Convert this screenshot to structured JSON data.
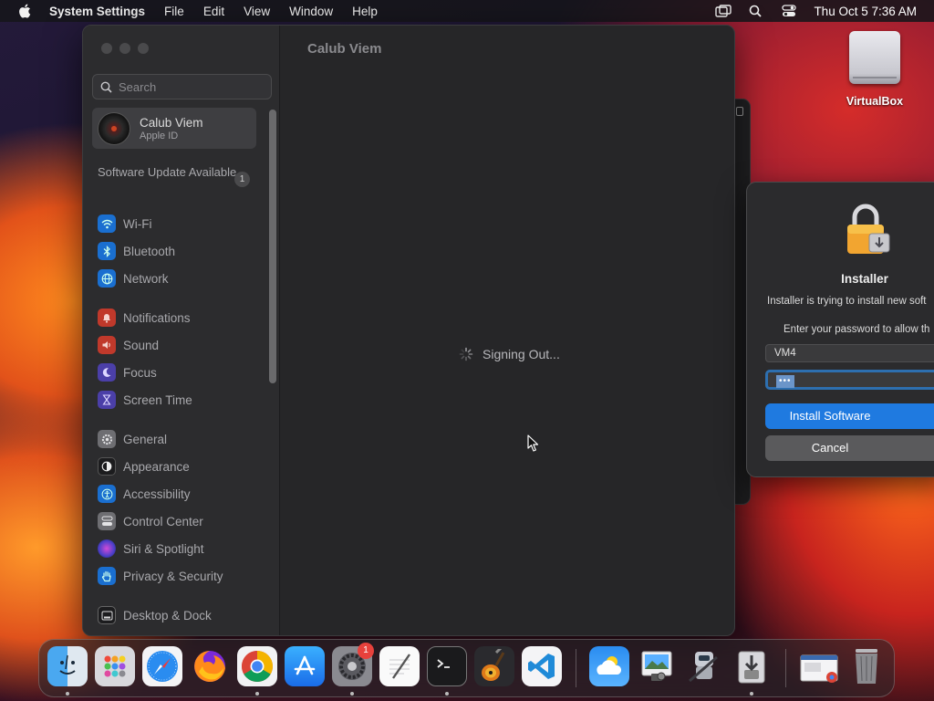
{
  "menubar": {
    "app_name": "System Settings",
    "items": [
      "File",
      "Edit",
      "View",
      "Window",
      "Help"
    ],
    "clock": "Thu Oct 5  7:36 AM"
  },
  "desktop": {
    "icons": [
      {
        "label": "VirtualBox",
        "icon": "external-drive-icon"
      }
    ]
  },
  "settings": {
    "content_title": "Calub Viem",
    "search_placeholder": "Search",
    "account": {
      "name": "Calub Viem",
      "subtitle": "Apple ID"
    },
    "software_update": {
      "label": "Software Update Available",
      "count": "1"
    },
    "sidebar_items": [
      {
        "label": "Wi-Fi",
        "icon": "wifi-icon"
      },
      {
        "label": "Bluetooth",
        "icon": "bluetooth-icon"
      },
      {
        "label": "Network",
        "icon": "globe-icon"
      },
      {
        "label": "Notifications",
        "icon": "bell-icon"
      },
      {
        "label": "Sound",
        "icon": "speaker-icon"
      },
      {
        "label": "Focus",
        "icon": "moon-icon"
      },
      {
        "label": "Screen Time",
        "icon": "hourglass-icon"
      },
      {
        "label": "General",
        "icon": "gear-icon"
      },
      {
        "label": "Appearance",
        "icon": "contrast-icon"
      },
      {
        "label": "Accessibility",
        "icon": "accessibility-icon"
      },
      {
        "label": "Control Center",
        "icon": "toggles-icon"
      },
      {
        "label": "Siri & Spotlight",
        "icon": "siri-icon"
      },
      {
        "label": "Privacy & Security",
        "icon": "hand-icon"
      },
      {
        "label": "Desktop & Dock",
        "icon": "dock-icon"
      }
    ],
    "status_text": "Signing Out..."
  },
  "installer": {
    "title": "Installer",
    "message": "Installer is trying to install new soft",
    "prompt": "Enter your password to allow th",
    "username": "VM4",
    "password_mask": "•••",
    "install_button": "Install Software",
    "cancel_button": "Cancel"
  },
  "dock": {
    "apps": [
      {
        "name": "Finder",
        "icon": "finder-icon",
        "running": true
      },
      {
        "name": "Launchpad",
        "icon": "launchpad-icon",
        "running": false
      },
      {
        "name": "Safari",
        "icon": "safari-icon",
        "running": false
      },
      {
        "name": "Firefox",
        "icon": "firefox-icon",
        "running": false
      },
      {
        "name": "Chrome",
        "icon": "chrome-icon",
        "running": true
      },
      {
        "name": "App Store",
        "icon": "app-store-icon",
        "running": false
      },
      {
        "name": "System Settings",
        "icon": "system-settings-icon",
        "running": true,
        "badge": "1"
      },
      {
        "name": "TextEdit",
        "icon": "textedit-icon",
        "running": false
      },
      {
        "name": "Terminal",
        "icon": "terminal-icon",
        "running": true
      },
      {
        "name": "GarageBand",
        "icon": "guitar-icon",
        "running": false
      },
      {
        "name": "VS Code",
        "icon": "vscode-icon",
        "running": false
      },
      {
        "name": "Weather",
        "icon": "weather-icon",
        "running": false
      },
      {
        "name": "Preview",
        "icon": "preview-icon",
        "running": false
      },
      {
        "name": "Automator",
        "icon": "automator-icon",
        "running": false
      },
      {
        "name": "Installer",
        "icon": "installer-icon",
        "running": true
      },
      {
        "name": "Downloads",
        "icon": "downloads-stack-icon",
        "running": false
      },
      {
        "name": "Trash",
        "icon": "trash-icon",
        "running": false
      }
    ]
  },
  "colors": {
    "accent": "#1f7ae0",
    "badge": "#e8413c"
  }
}
